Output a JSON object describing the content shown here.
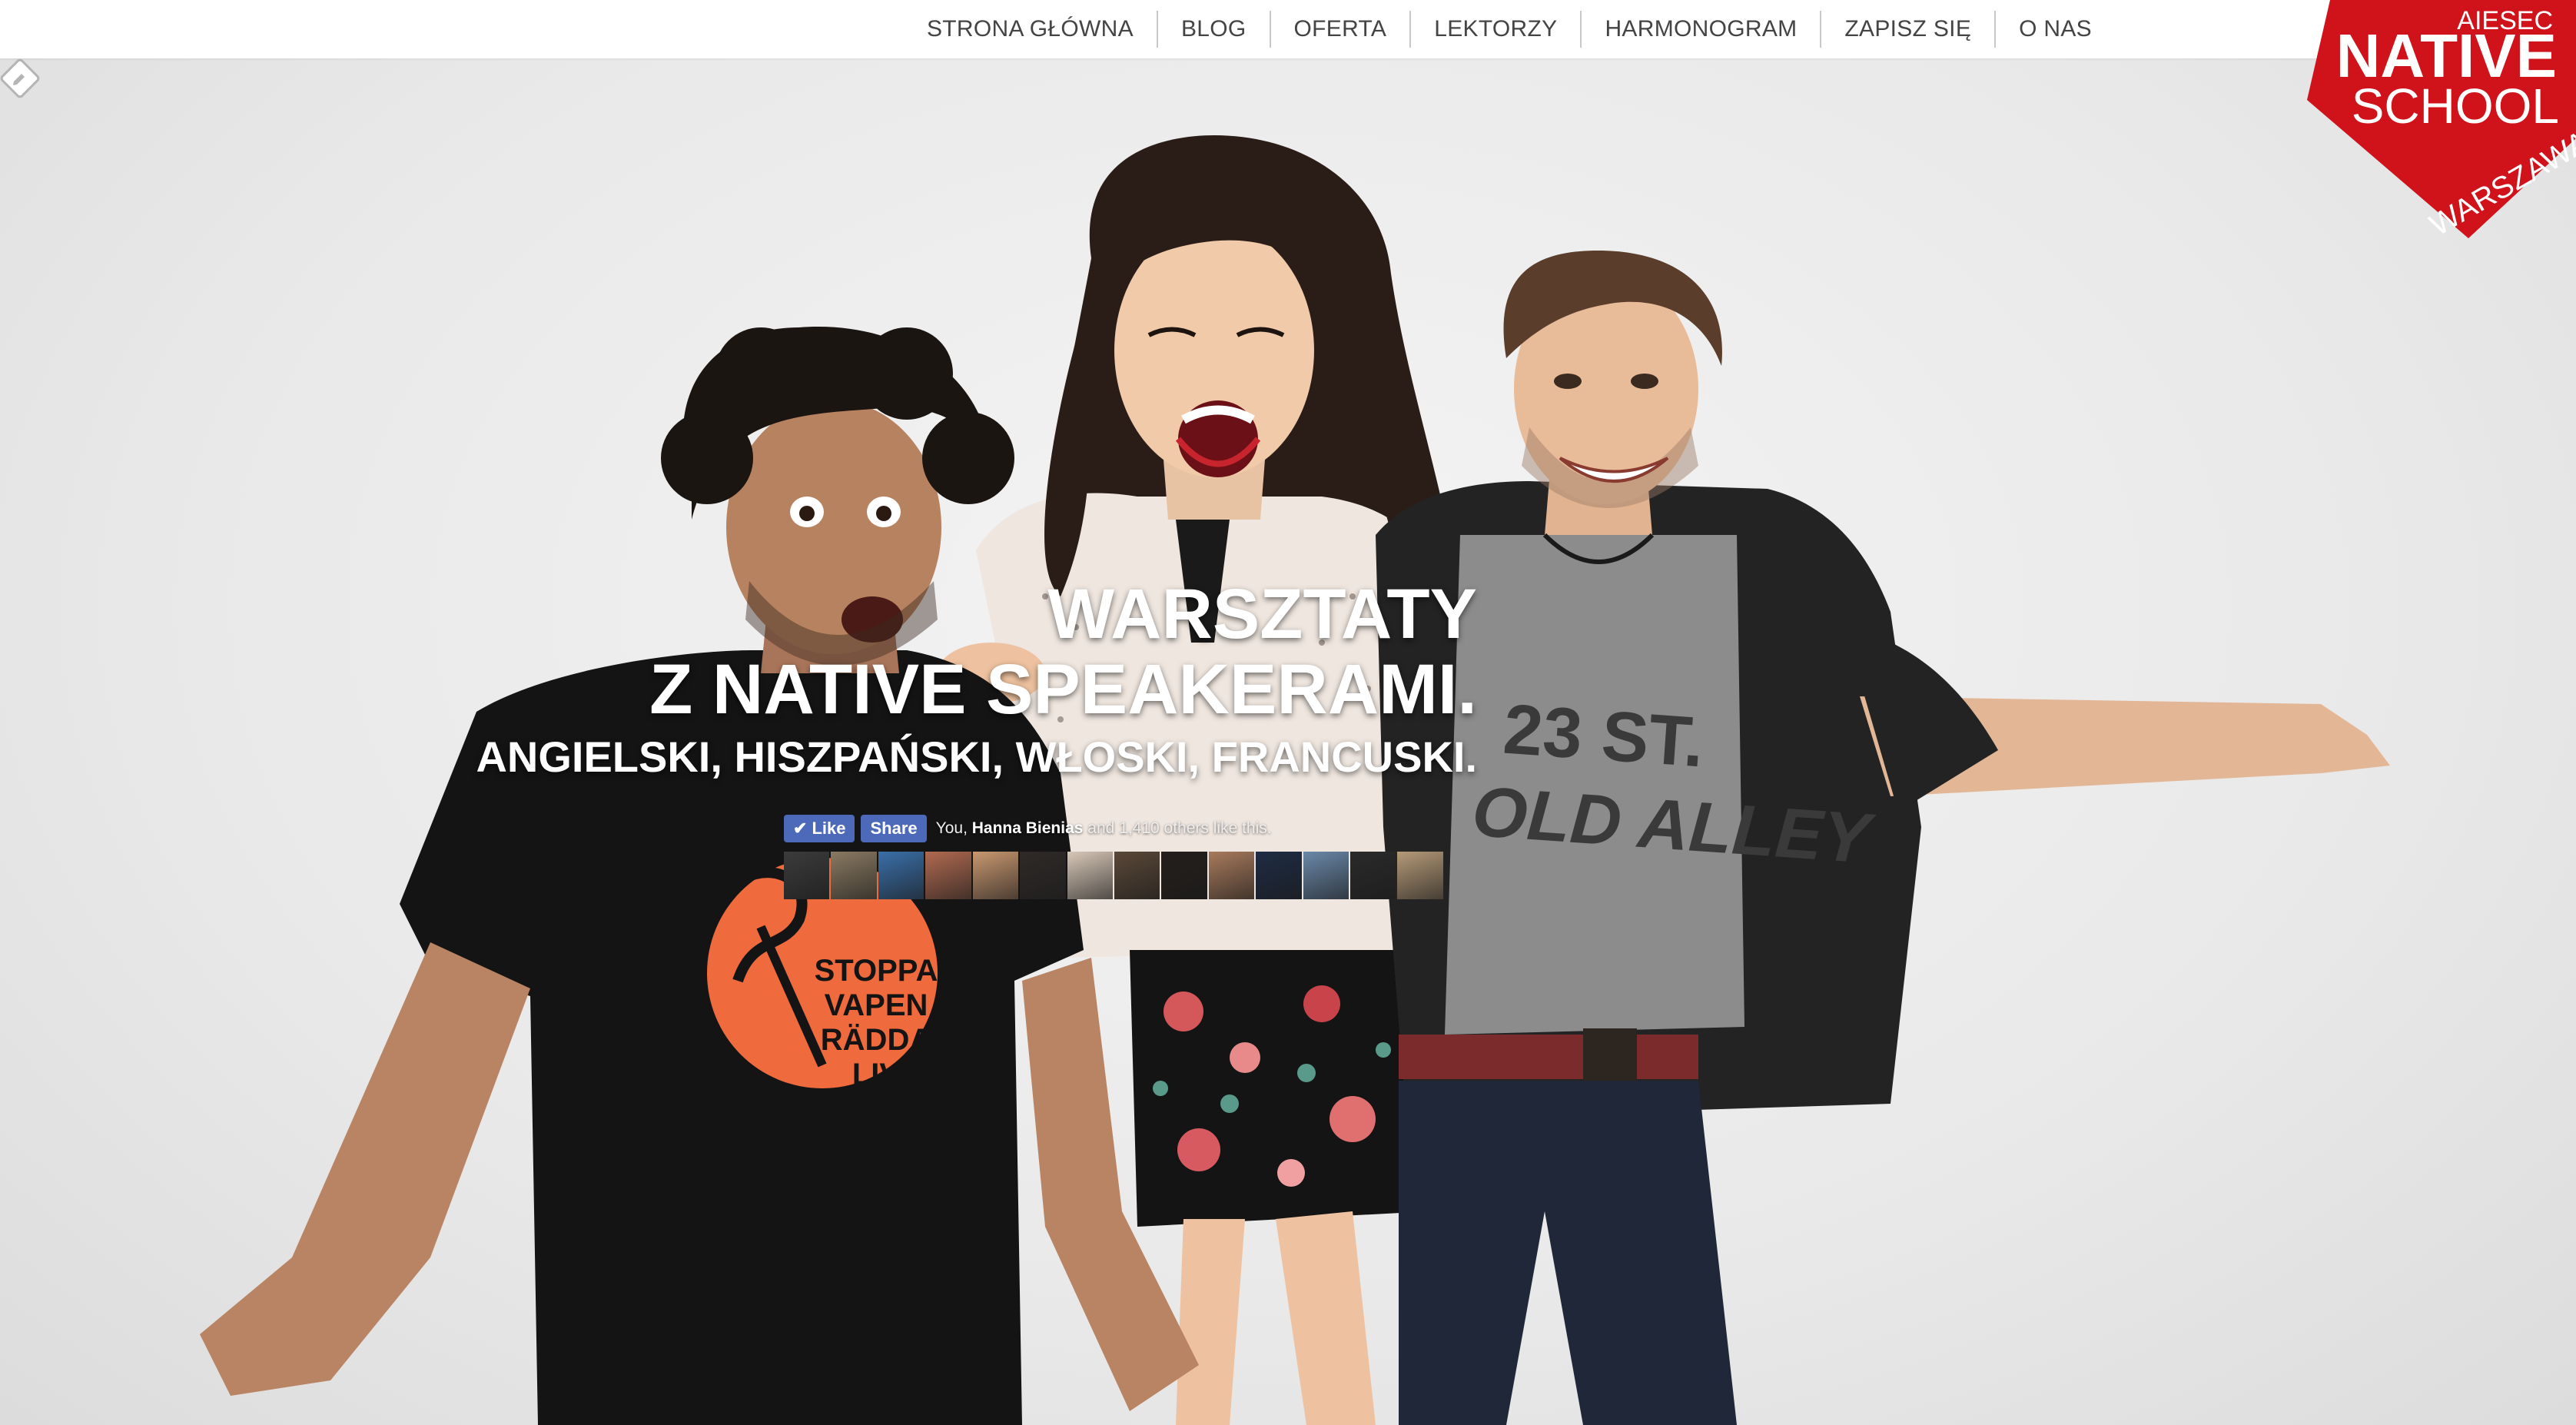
{
  "nav": {
    "items": [
      "STRONA GŁÓWNA",
      "BLOG",
      "OFERTA",
      "LEKTORZY",
      "HARMONOGRAM",
      "ZAPISZ SIĘ",
      "O NAS"
    ]
  },
  "logo": {
    "small": "AIESEC",
    "line1": "NATIVE",
    "line2": "SCHOOL",
    "city": "WARSZAWA",
    "color": "#d0121b"
  },
  "hero": {
    "headline_1": "WARSZTATY",
    "headline_2": "Z NATIVE SPEAKERAMI.",
    "languages": "ANGIELSKI, HISZPAŃSKI, WŁOSKI, FRANCUSKI.",
    "shirt_text": [
      "STOPPA",
      "VAPEN",
      "RÄDDA",
      "LIV"
    ],
    "shirt2_text": [
      "23 ST.",
      "OLD ALLEY"
    ]
  },
  "facebook": {
    "like_label": "Like",
    "share_label": "Share",
    "text_prefix": "You, ",
    "text_name": "Hanna Bienias",
    "text_suffix": " and 1,410 others like this.",
    "face_colors": [
      "#3b3b3b",
      "#8a7a62",
      "#3a6fa8",
      "#b06a50",
      "#c89870",
      "#2f2a28",
      "#d8c8b8",
      "#5a4838",
      "#241f1c",
      "#a87a5c",
      "#1e2c44",
      "#6a88a8",
      "#2a2a2a",
      "#b59a78"
    ]
  }
}
